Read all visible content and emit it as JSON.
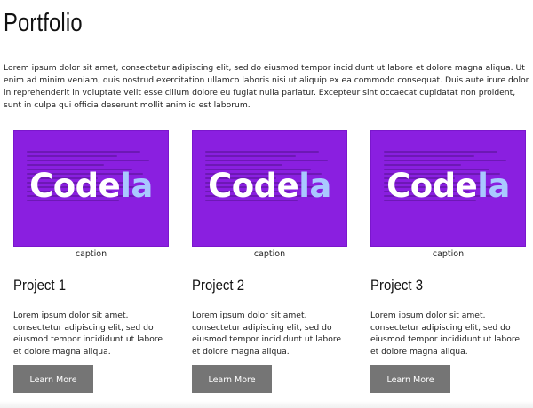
{
  "page": {
    "title": "Portfolio",
    "intro": "Lorem ipsum dolor sit amet, consectetur adipiscing elit, sed do eiusmod tempor incididunt ut labore et dolore magna aliqua. Ut enim ad minim veniam, quis nostrud exercitation ullamco laboris nisi ut aliquip ex ea commodo consequat. Duis aute irure dolor in reprehenderit in voluptate velit esse cillum dolore eu fugiat nulla pariatur. Excepteur sint occaecat cupidatat non proident, sunt in culpa qui officia deserunt mollit anim id est laborum."
  },
  "projects": [
    {
      "logo_part1": "Code",
      "logo_part2": "la",
      "caption": "caption",
      "title": "Project 1",
      "text": "Lorem ipsum dolor sit amet, consectetur adipiscing elit, sed do eiusmod tempor incididunt ut labore et dolore magna aliqua.",
      "button": "Learn More"
    },
    {
      "logo_part1": "Code",
      "logo_part2": "la",
      "caption": "caption",
      "title": "Project 2",
      "text": "Lorem ipsum dolor sit amet, consectetur adipiscing elit, sed do eiusmod tempor incididunt ut labore et dolore magna aliqua.",
      "button": "Learn More"
    },
    {
      "logo_part1": "Code",
      "logo_part2": "la",
      "caption": "caption",
      "title": "Project 3",
      "text": "Lorem ipsum dolor sit amet, consectetur adipiscing elit, sed do eiusmod tempor incididunt ut labore et dolore magna aliqua.",
      "button": "Learn More"
    }
  ],
  "colors": {
    "thumbnail_bg": "#8a1fe0",
    "logo_accent": "#a9c8ff",
    "button_bg": "#757575"
  }
}
